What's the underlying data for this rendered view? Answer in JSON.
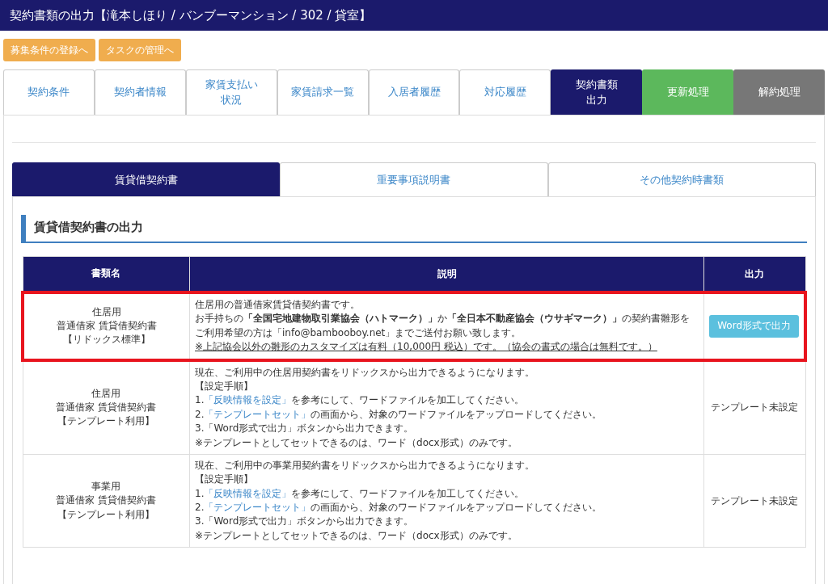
{
  "header": {
    "title": "契約書類の出力【滝本しほり / バンブーマンション / 302 / 貸室】"
  },
  "action_buttons": [
    "募集条件の登録へ",
    "タスクの管理へ"
  ],
  "main_tabs": [
    {
      "label": [
        "契約条件"
      ],
      "selected": false,
      "kind": "normal"
    },
    {
      "label": [
        "契約者情報"
      ],
      "selected": false,
      "kind": "normal"
    },
    {
      "label": [
        "家賃支払い",
        "状況"
      ],
      "selected": false,
      "kind": "normal"
    },
    {
      "label": [
        "家賃請求一覧"
      ],
      "selected": false,
      "kind": "normal"
    },
    {
      "label": [
        "入居者履歴"
      ],
      "selected": false,
      "kind": "normal"
    },
    {
      "label": [
        "対応履歴"
      ],
      "selected": false,
      "kind": "normal"
    },
    {
      "label": [
        "契約書類",
        "出力"
      ],
      "selected": true,
      "kind": "normal"
    },
    {
      "label": [
        "更新処理"
      ],
      "selected": false,
      "kind": "renew"
    },
    {
      "label": [
        "解約処理"
      ],
      "selected": false,
      "kind": "cancel"
    }
  ],
  "doc_tabs": [
    {
      "label": "賃貸借契約書",
      "selected": true
    },
    {
      "label": "重要事項説明書",
      "selected": false
    },
    {
      "label": "その他契約時書類",
      "selected": false
    }
  ],
  "section_title": "賃貸借契約書の出力",
  "table": {
    "columns": [
      "書類名",
      "説明",
      "出力"
    ],
    "rows": [
      {
        "highlighted": true,
        "name": [
          "住居用",
          "普通借家 賃貸借契約書",
          "【リドックス標準】"
        ],
        "lines": [
          {
            "underline": false,
            "segments": [
              {
                "kind": "text",
                "text": "住居用の普通借家賃貸借契約書です。"
              }
            ]
          },
          {
            "underline": false,
            "segments": [
              {
                "kind": "text",
                "text": "お手持ちの**「全国宅地建物取引業協会（ハトマーク）」**か**「全日本不動産協会（ウサギマーク）」**の契約書雛形をご利用希望の方は「info@bambooboy.net」までご送付お願い致します。"
              }
            ]
          },
          {
            "underline": true,
            "segments": [
              {
                "kind": "text",
                "text": "※上記協会以外の雛形のカスタマイズは有料（10,000円 税込）です。（協会の書式の場合は無料です。）"
              }
            ]
          }
        ],
        "output": {
          "kind": "button",
          "text": "Word形式で出力"
        }
      },
      {
        "highlighted": false,
        "name": [
          "住居用",
          "普通借家 賃貸借契約書",
          "【テンプレート利用】"
        ],
        "lines": [
          {
            "underline": false,
            "segments": [
              {
                "kind": "text",
                "text": "現在、ご利用中の住居用契約書をリドックスから出力できるようになります。"
              }
            ]
          },
          {
            "underline": false,
            "segments": [
              {
                "kind": "text",
                "text": "【設定手順】"
              }
            ]
          },
          {
            "underline": false,
            "segments": [
              {
                "kind": "text",
                "text": "1."
              },
              {
                "kind": "link",
                "text": "「反映情報を設定」"
              },
              {
                "kind": "text",
                "text": "を参考にして、ワードファイルを加工してください。"
              }
            ]
          },
          {
            "underline": false,
            "segments": [
              {
                "kind": "text",
                "text": "2."
              },
              {
                "kind": "link",
                "text": "「テンプレートセット」"
              },
              {
                "kind": "text",
                "text": "の画面から、対象のワードファイルをアップロードしてください。"
              }
            ]
          },
          {
            "underline": false,
            "segments": [
              {
                "kind": "text",
                "text": "3.「Word形式で出力」ボタンから出力できます。"
              }
            ]
          },
          {
            "underline": false,
            "segments": [
              {
                "kind": "text",
                "text": "※テンプレートとしてセットできるのは、ワード（docx形式）のみです。"
              }
            ]
          }
        ],
        "output": {
          "kind": "text",
          "text": "テンプレート未設定"
        }
      },
      {
        "highlighted": false,
        "name": [
          "事業用",
          "普通借家 賃貸借契約書",
          "【テンプレート利用】"
        ],
        "lines": [
          {
            "underline": false,
            "segments": [
              {
                "kind": "text",
                "text": "現在、ご利用中の事業用契約書をリドックスから出力できるようになります。"
              }
            ]
          },
          {
            "underline": false,
            "segments": [
              {
                "kind": "text",
                "text": "【設定手順】"
              }
            ]
          },
          {
            "underline": false,
            "segments": [
              {
                "kind": "text",
                "text": "1."
              },
              {
                "kind": "link",
                "text": "「反映情報を設定」"
              },
              {
                "kind": "text",
                "text": "を参考にして、ワードファイルを加工してください。"
              }
            ]
          },
          {
            "underline": false,
            "segments": [
              {
                "kind": "text",
                "text": "2."
              },
              {
                "kind": "link",
                "text": "「テンプレートセット」"
              },
              {
                "kind": "text",
                "text": "の画面から、対象のワードファイルをアップロードしてください。"
              }
            ]
          },
          {
            "underline": false,
            "segments": [
              {
                "kind": "text",
                "text": "3.「Word形式で出力」ボタンから出力できます。"
              }
            ]
          },
          {
            "underline": false,
            "segments": [
              {
                "kind": "text",
                "text": "※テンプレートとしてセットできるのは、ワード（docx形式）のみです。"
              }
            ]
          }
        ],
        "output": {
          "kind": "text",
          "text": "テンプレート未設定"
        }
      }
    ]
  }
}
